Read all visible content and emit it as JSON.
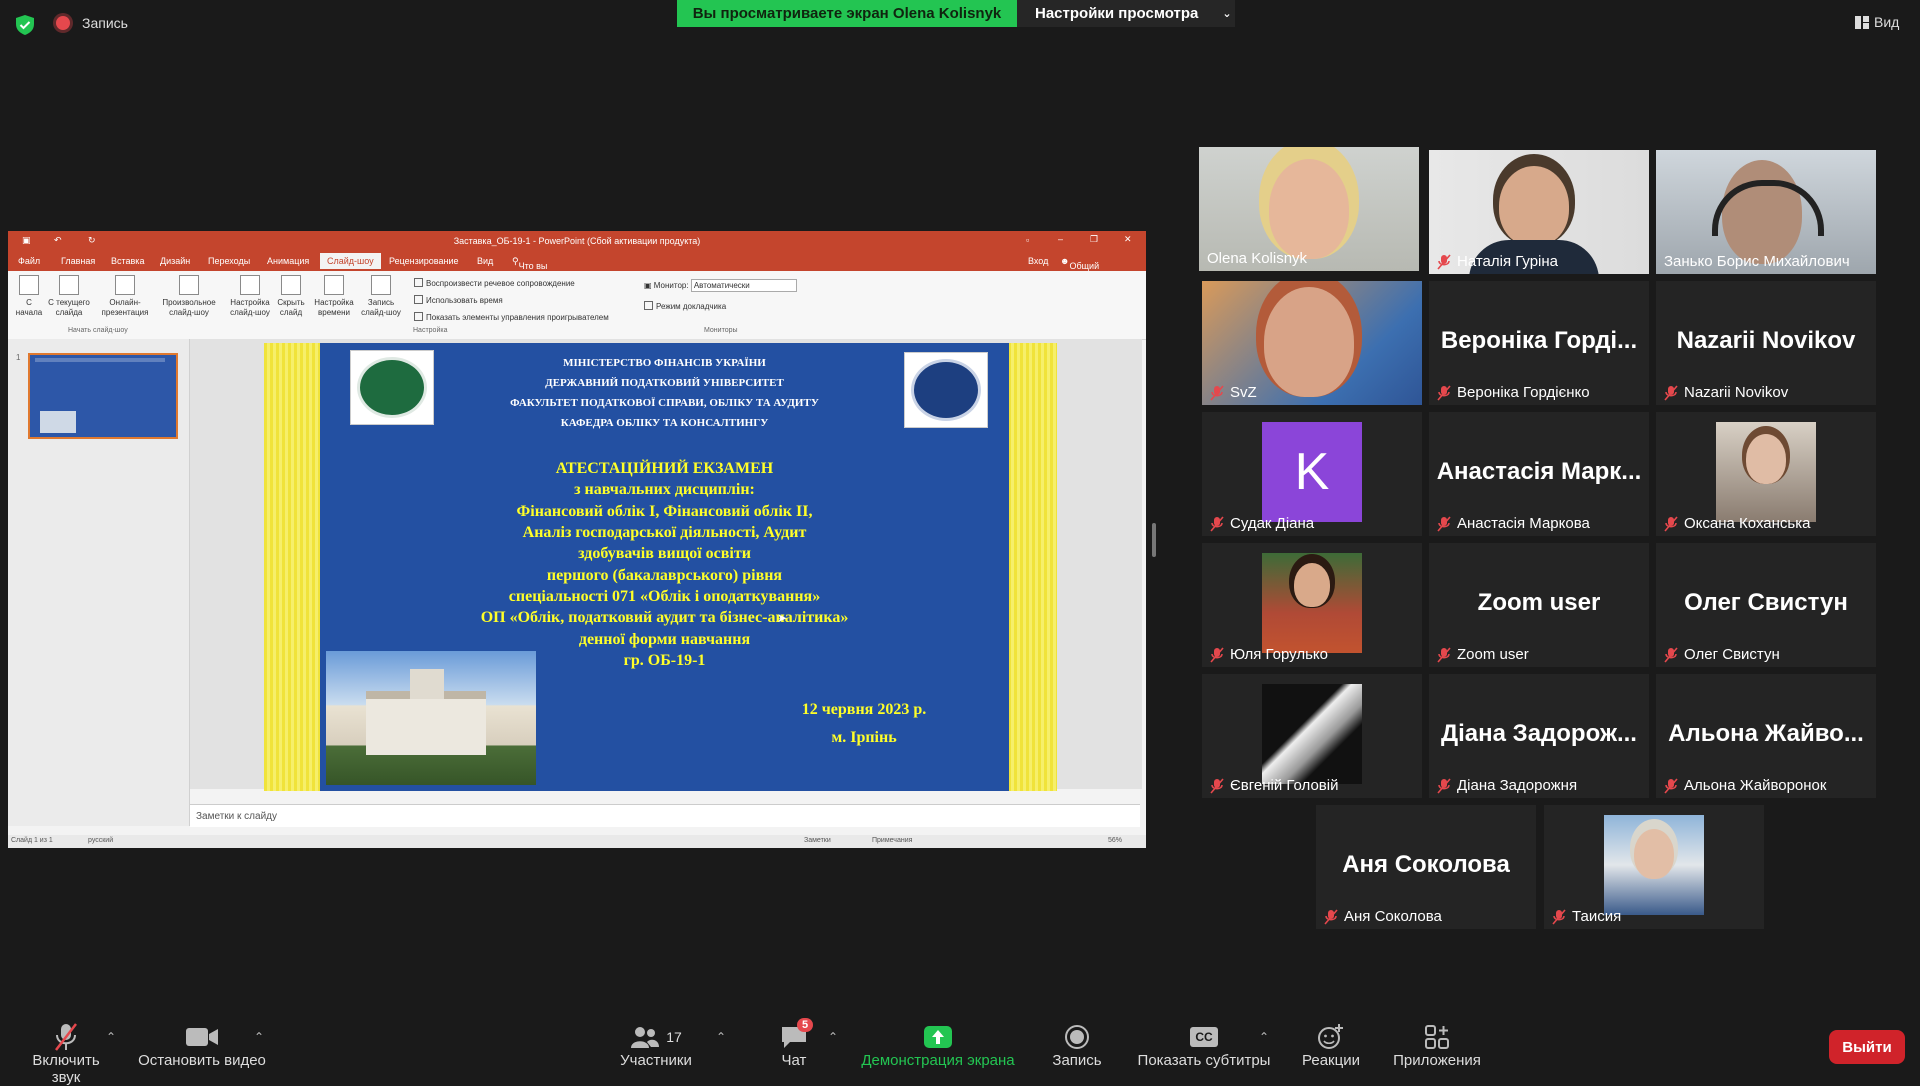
{
  "topbar": {
    "recording_label": "Запись",
    "viewing_banner": "Вы просматриваете экран Olena Kolisnyk",
    "view_settings_label": "Настройки просмотра",
    "view_button_label": "Вид"
  },
  "ppt": {
    "window_title": "Заставка_ОБ-19-1 - PowerPoint (Сбой активации продукта)",
    "menu": [
      "Файл",
      "Главная",
      "Вставка",
      "Дизайн",
      "Переходы",
      "Анимация",
      "Слайд-шоу",
      "Рецензирование",
      "Вид"
    ],
    "active_menu": "Слайд-шоу",
    "tell_me": "Что вы хотите сделать?",
    "sign_in": "Вход",
    "share": "Общий доступ",
    "ribbon": {
      "from_start": "С начала",
      "from_current": "С текущего слайда",
      "online": "Онлайн-презентация",
      "custom": "Произвольное слайд-шоу",
      "group_start": "Начать слайд-шоу",
      "setup": "Настройка слайд-шоу",
      "hide": "Скрыть слайд",
      "timings": "Настройка времени",
      "record": "Запись слайд-шоу",
      "group_setup": "Настройка",
      "chk_narration": "Воспроизвести речевое сопровождение",
      "chk_timings": "Использовать время",
      "chk_controls": "Показать элементы управления проигрывателем",
      "monitor_label": "Монитор:",
      "monitor_value": "Автоматически",
      "presenter_view": "Режим докладчика",
      "group_monitors": "Мониторы"
    },
    "thumb_number": "1",
    "notes_placeholder": "Заметки к слайду",
    "status": {
      "slide": "Слайд 1 из 1",
      "lang": "русский",
      "notes": "Заметки",
      "comments": "Примечания",
      "zoom": "56%"
    }
  },
  "slide": {
    "header_lines": [
      "МІНІСТЕРСТВО ФІНАНСІВ УКРАЇНИ",
      "ДЕРЖАВНИЙ ПОДАТКОВИЙ УНІВЕРСИТЕТ",
      "ФАКУЛЬТЕТ ПОДАТКОВОЇ СПРАВИ, ОБЛІКУ ТА АУДИТУ",
      "КАФЕДРА ОБЛІКУ ТА КОНСАЛТИНГУ"
    ],
    "body_lines": [
      "АТЕСТАЦІЙНИЙ ЕКЗАМЕН",
      "з навчальних дисциплін:",
      "Фінансовий облік І, Фінансовий облік ІІ,",
      "Аналіз господарської діяльності, Аудит",
      "здобувачів вищої освіти",
      "першого (бакалаврського) рівня",
      "спеціальності 071 «Облік і оподаткування»",
      "ОП «Облік, податковий аудит та бізнес-аналітика»",
      "денної форми навчання",
      "гр. ОБ-19-1"
    ],
    "date": "12 червня 2023 р.",
    "city": "м. Ірпінь"
  },
  "participants": [
    {
      "name": "Olena Kolisnyk",
      "type": "video",
      "active": true,
      "muted": false
    },
    {
      "name": "Наталія Гуріна",
      "type": "video",
      "muted": true
    },
    {
      "name": "Занько Борис Михайлович",
      "type": "video",
      "muted": false
    },
    {
      "name": "SvZ",
      "type": "video",
      "muted": true
    },
    {
      "name": "Вероніка Гордієнко",
      "big": "Вероніка Горді...",
      "type": "text",
      "muted": true
    },
    {
      "name": "Nazarii Novikov",
      "big": "Nazarii Novikov",
      "type": "text",
      "muted": true
    },
    {
      "name": "Судак Діана",
      "avatar_letter": "K",
      "type": "avatar",
      "muted": true
    },
    {
      "name": "Анастасія Маркова",
      "big": "Анастасія Марк...",
      "type": "text",
      "muted": true
    },
    {
      "name": "Оксана Коханська",
      "type": "image",
      "muted": true
    },
    {
      "name": "Юля Горулько",
      "type": "image",
      "muted": true
    },
    {
      "name": "Zoom user",
      "big": "Zoom user",
      "type": "text",
      "muted": true
    },
    {
      "name": "Олег Свистун",
      "big": "Олег Свистун",
      "type": "text",
      "muted": true
    },
    {
      "name": "Євгеній Головій",
      "type": "image",
      "muted": true
    },
    {
      "name": "Діана Задорожня",
      "big": "Діана Задорож...",
      "type": "text",
      "muted": true
    },
    {
      "name": "Альона Жайворонок",
      "big": "Альона Жайво...",
      "type": "text",
      "muted": true
    },
    {
      "name": "Аня Соколова",
      "big": "Аня Соколова",
      "type": "text",
      "muted": true
    },
    {
      "name": "Таисия",
      "type": "image",
      "muted": true
    }
  ],
  "toolbar": {
    "unmute": "Включить звук",
    "stop_video": "Остановить видео",
    "participants": "Участники",
    "participants_count": "17",
    "chat": "Чат",
    "chat_badge": "5",
    "share_screen": "Демонстрация экрана",
    "record": "Запись",
    "captions": "Показать субтитры",
    "cc_icon_text": "CC",
    "reactions": "Реакции",
    "apps": "Приложения",
    "leave": "Выйти"
  },
  "colors": {
    "share_green": "#23c552",
    "leave_red": "#d0232a",
    "ppt_red": "#c4452d",
    "slide_blue": "#2350a2",
    "slide_yellow_text": "#ffff28",
    "active_speaker": "#dfe64a"
  }
}
